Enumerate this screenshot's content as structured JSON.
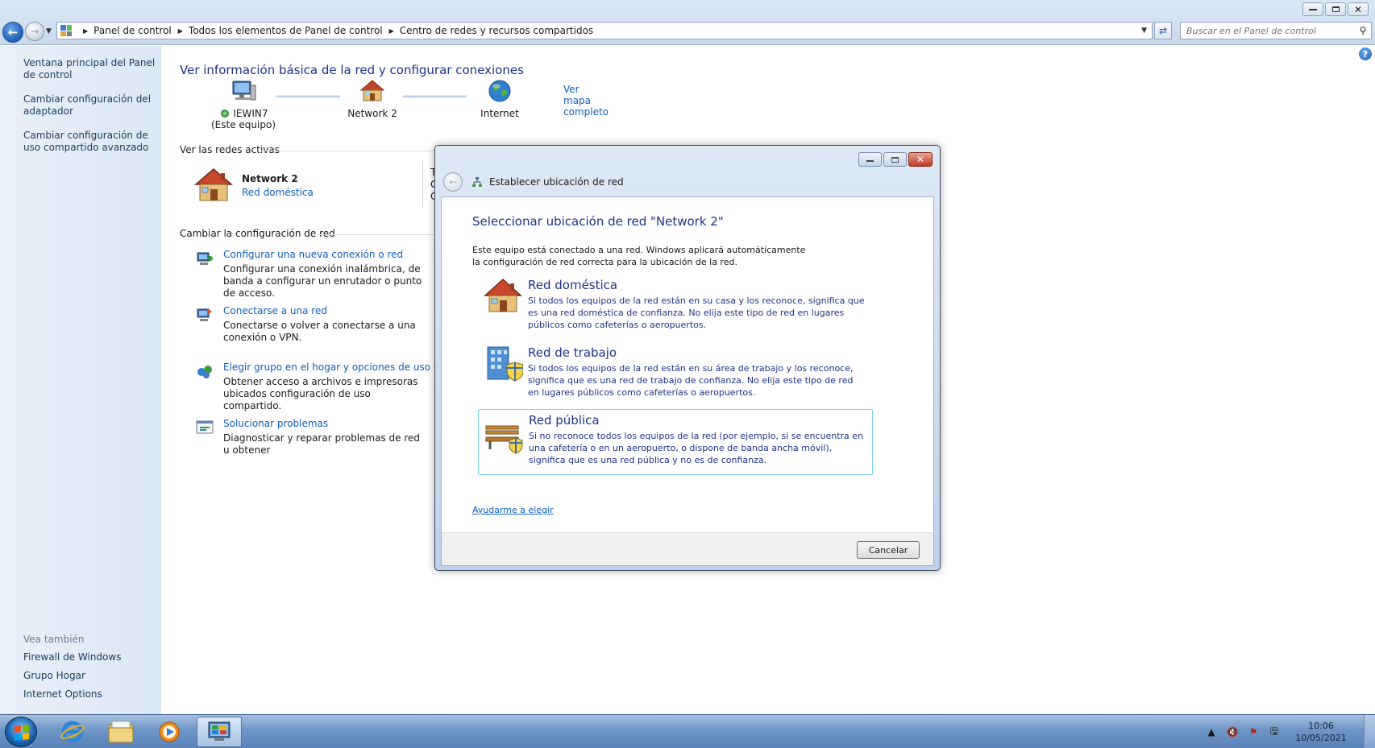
{
  "window": {
    "minimize_label": "",
    "maximize_label": "",
    "close_label": "✕"
  },
  "address": {
    "crumbs": [
      "Panel de control",
      "Todos los elementos de Panel de control",
      "Centro de redes y recursos compartidos"
    ],
    "search_placeholder": "Buscar en el Panel de control"
  },
  "sidebar": {
    "top_links": [
      "Ventana principal del Panel de control",
      "Cambiar configuración del adaptador",
      "Cambiar configuración de uso compartido avanzado"
    ],
    "see_also_heading": "Vea también",
    "see_also_links": [
      "Firewall de Windows",
      "Grupo Hogar",
      "Internet Options"
    ]
  },
  "main": {
    "title": "Ver información básica de la red y configurar conexiones",
    "map": {
      "computer_name": "IEWIN7",
      "computer_sub": "(Este equipo)",
      "network_name": "Network  2",
      "internet": "Internet",
      "full_map_link": "Ver mapa completo"
    },
    "active_networks_label": "Ver las redes activas",
    "active_network": {
      "name": "Network  2",
      "type": "Red doméstica"
    },
    "clipped_chars": [
      "T",
      "C",
      "C"
    ],
    "change_settings_label": "Cambiar la configuración de red",
    "tasks": [
      {
        "link": "Configurar una nueva conexión o red",
        "desc": "Configurar una conexión inalámbrica, de banda a configurar un enrutador o punto de acceso."
      },
      {
        "link": "Conectarse a una red",
        "desc": "Conectarse o volver a conectarse a una conexión o VPN."
      },
      {
        "link": "Elegir grupo en el hogar y opciones de uso compa",
        "desc": "Obtener acceso a archivos e impresoras ubicados configuración de uso compartido."
      },
      {
        "link": "Solucionar problemas",
        "desc": "Diagnosticar y reparar problemas de red u obtener"
      }
    ]
  },
  "dialog": {
    "title": "Establecer ubicación de red",
    "heading": "Seleccionar ubicación de red \"Network  2\"",
    "intro": "Este equipo está conectado a una red. Windows aplicará automáticamente la configuración de red correcta para la ubicación de la red.",
    "locations": [
      {
        "title": "Red doméstica",
        "desc": "Si todos los equipos de la red están en su casa y los reconoce, significa que es una red doméstica de confianza. No elija este tipo de red en lugares públicos como cafeterías o aeropuertos."
      },
      {
        "title": "Red de trabajo",
        "desc": "Si todos los equipos de la red están en su área de trabajo y los reconoce, significa que es una red de trabajo de confianza. No elija este tipo de red en lugares públicos como cafeterías o aeropuertos."
      },
      {
        "title": "Red pública",
        "desc": "Si no reconoce todos los equipos de la red (por ejemplo, si se encuentra en una cafetería o en un aeropuerto, o dispone de banda ancha móvil), significa que es una red pública y no es de confianza."
      }
    ],
    "help_link": "Ayudarme a elegir",
    "cancel_label": "Cancelar"
  },
  "taskbar": {
    "clock_time": "10:06",
    "clock_date": "10/05/2021"
  },
  "colors": {
    "link": "#0e5fbe",
    "heading": "#1e3287",
    "sidebar_bg": "#e3ecf7",
    "taskbar": "#6e95c6"
  }
}
